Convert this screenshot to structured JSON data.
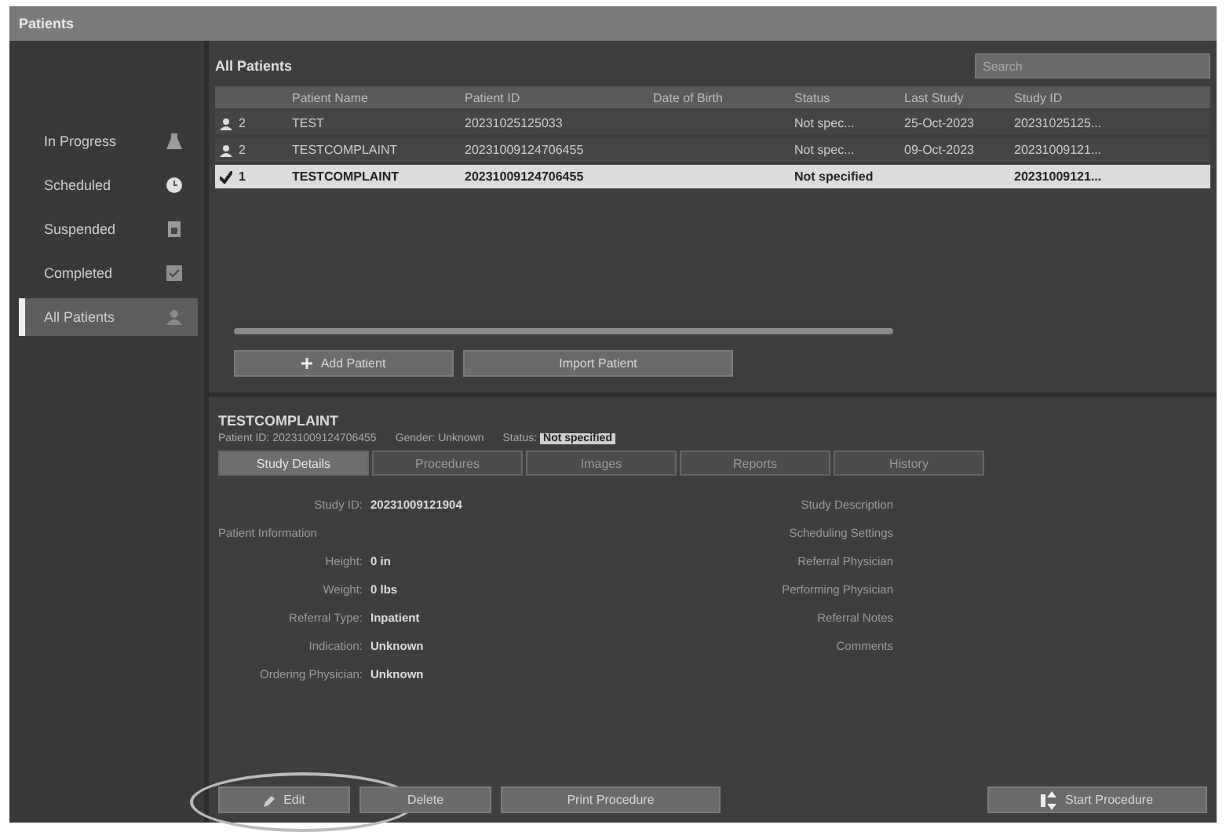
{
  "window": {
    "title": "Patients"
  },
  "sidebar": {
    "items": [
      {
        "label": "In Progress",
        "selected": false
      },
      {
        "label": "Scheduled",
        "selected": false
      },
      {
        "label": "Suspended",
        "selected": false
      },
      {
        "label": "Completed",
        "selected": false
      },
      {
        "label": "All Patients",
        "selected": true
      }
    ]
  },
  "list": {
    "title": "All Patients",
    "search": {
      "placeholder": "Search"
    },
    "columns": [
      "Patient Name",
      "Patient ID",
      "Date of Birth",
      "Status",
      "Last Study",
      "Study ID"
    ],
    "rows": [
      {
        "number": "2",
        "name": "TEST",
        "patient_id": "20231025125033",
        "status": "Not spec...",
        "last_study": "25-Oct-2023",
        "study_id": "20231025125...",
        "selected": false
      },
      {
        "number": "2",
        "name": "TESTCOMPLAINT",
        "patient_id": "20231009124706455",
        "status": "Not spec...",
        "last_study": "09-Oct-2023",
        "study_id": "20231009121...",
        "selected": false
      },
      {
        "number": "1",
        "name": "TESTCOMPLAINT",
        "patient_id": "20231009124706455",
        "status": "Not specified",
        "study_id": "20231009121...",
        "selected": true
      }
    ],
    "buttons": [
      "Add Patient",
      "Import Patient"
    ]
  },
  "details": {
    "name": "TESTCOMPLAINT",
    "info": [
      {
        "label": "Patient ID:",
        "value": "20231009124706455"
      },
      {
        "label": "Gender:",
        "value": "Unknown"
      },
      {
        "label": "Status:",
        "value": "Not specified"
      }
    ],
    "tabs": [
      {
        "label": "Study Details",
        "selected": true
      },
      {
        "label": "Procedures",
        "selected": false
      },
      {
        "label": "Images",
        "selected": false
      },
      {
        "label": "Reports",
        "selected": false
      },
      {
        "label": "History",
        "selected": false
      }
    ],
    "left_fields": [
      {
        "kind": "field",
        "label": "Study ID:",
        "value": "20231009121904"
      },
      {
        "kind": "section",
        "label": "Patient Information"
      },
      {
        "kind": "field",
        "label": "Height:",
        "value": "0 in"
      },
      {
        "kind": "field",
        "label": "Weight:",
        "value": "0 lbs"
      },
      {
        "kind": "field",
        "label": "Referral Type:",
        "value": "Inpatient"
      },
      {
        "kind": "field",
        "label": "Indication:",
        "value": "Unknown"
      },
      {
        "kind": "field",
        "label": "Ordering Physician:",
        "value": "Unknown"
      }
    ],
    "right_fields": [
      "Study Description",
      "Scheduling Settings",
      "Referral Physician",
      "Performing Physician",
      "Referral Notes",
      "Comments"
    ]
  },
  "footer": {
    "buttons": [
      {
        "label": "Edit",
        "circled": true
      },
      {
        "label": "Delete",
        "circled": false
      },
      {
        "label": "Print Procedure",
        "circled": false
      }
    ],
    "primary": "Start Procedure"
  }
}
